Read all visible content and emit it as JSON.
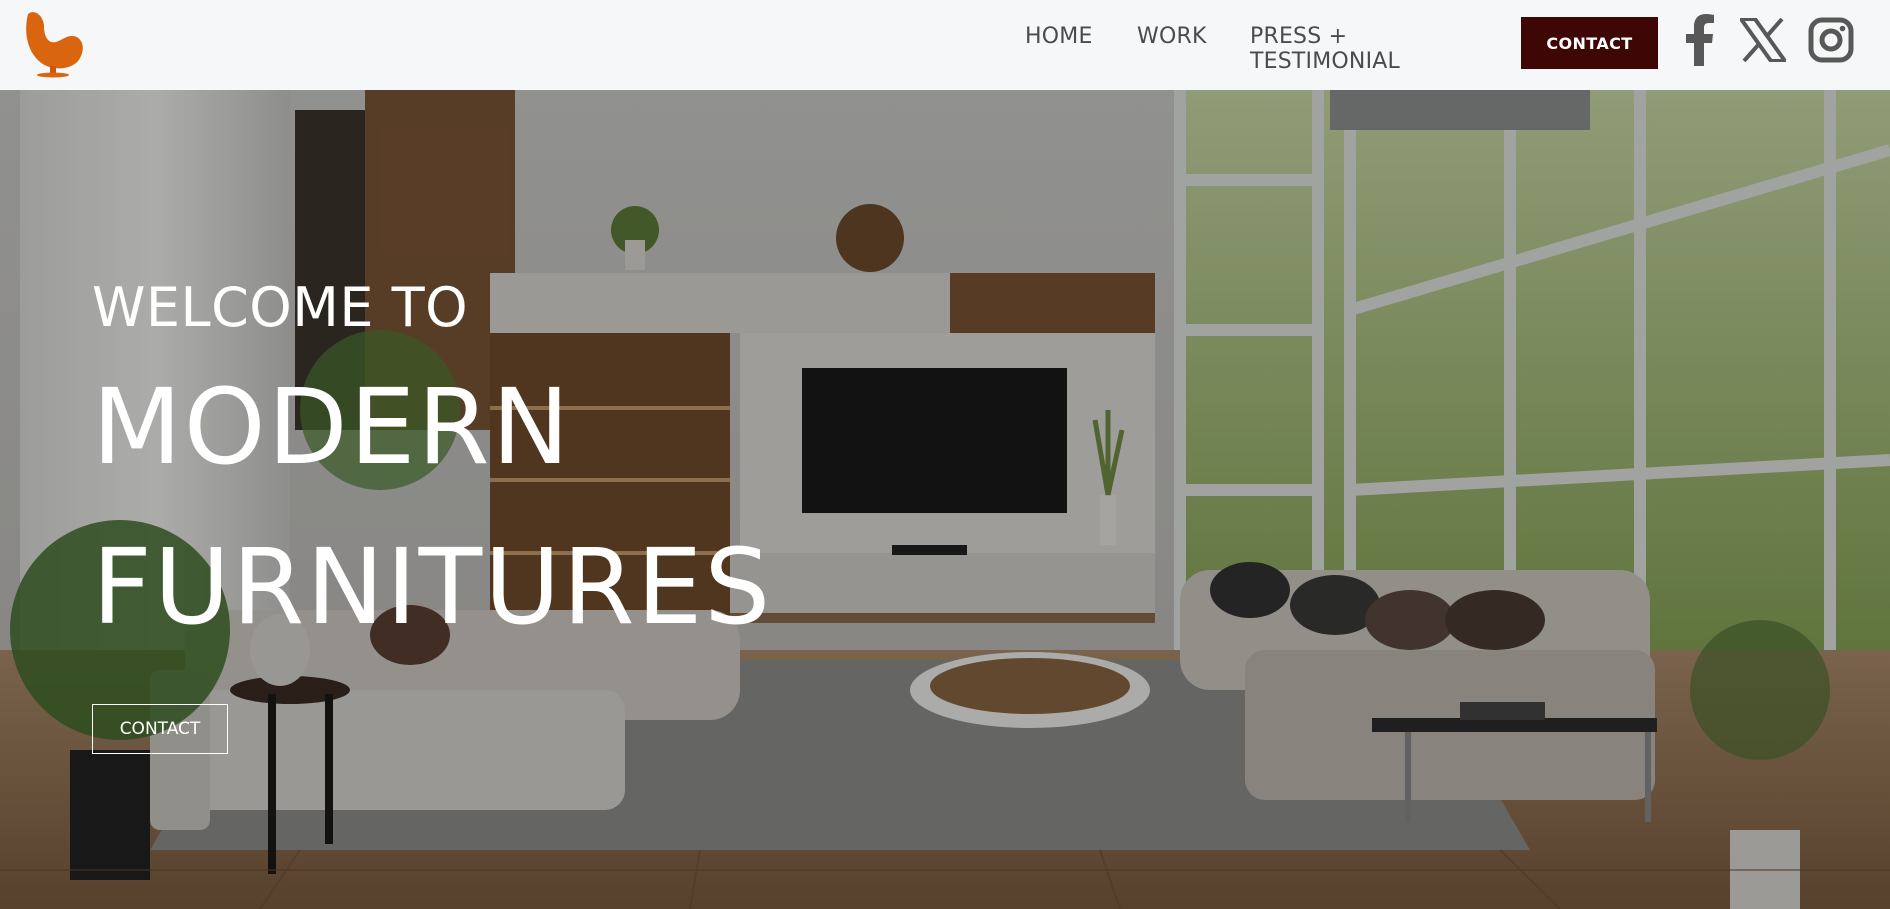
{
  "header": {
    "logo_icon": "egg-chair-logo-icon",
    "nav": [
      {
        "label": "HOME"
      },
      {
        "label": "WORK"
      },
      {
        "label": "PRESS + TESTIMONIAL"
      }
    ],
    "contact_label": "CONTACT",
    "social": [
      "facebook-icon",
      "x-icon",
      "instagram-icon"
    ]
  },
  "hero": {
    "welcome": "WELCOME TO",
    "line1": "MODERN",
    "line2": "FURNITURES",
    "cta_label": "CONTACT"
  },
  "colors": {
    "accent": "#3f0606",
    "logo": "#d9650f",
    "nav_text": "#4b4b4b",
    "header_bg": "#f6f7f9"
  }
}
